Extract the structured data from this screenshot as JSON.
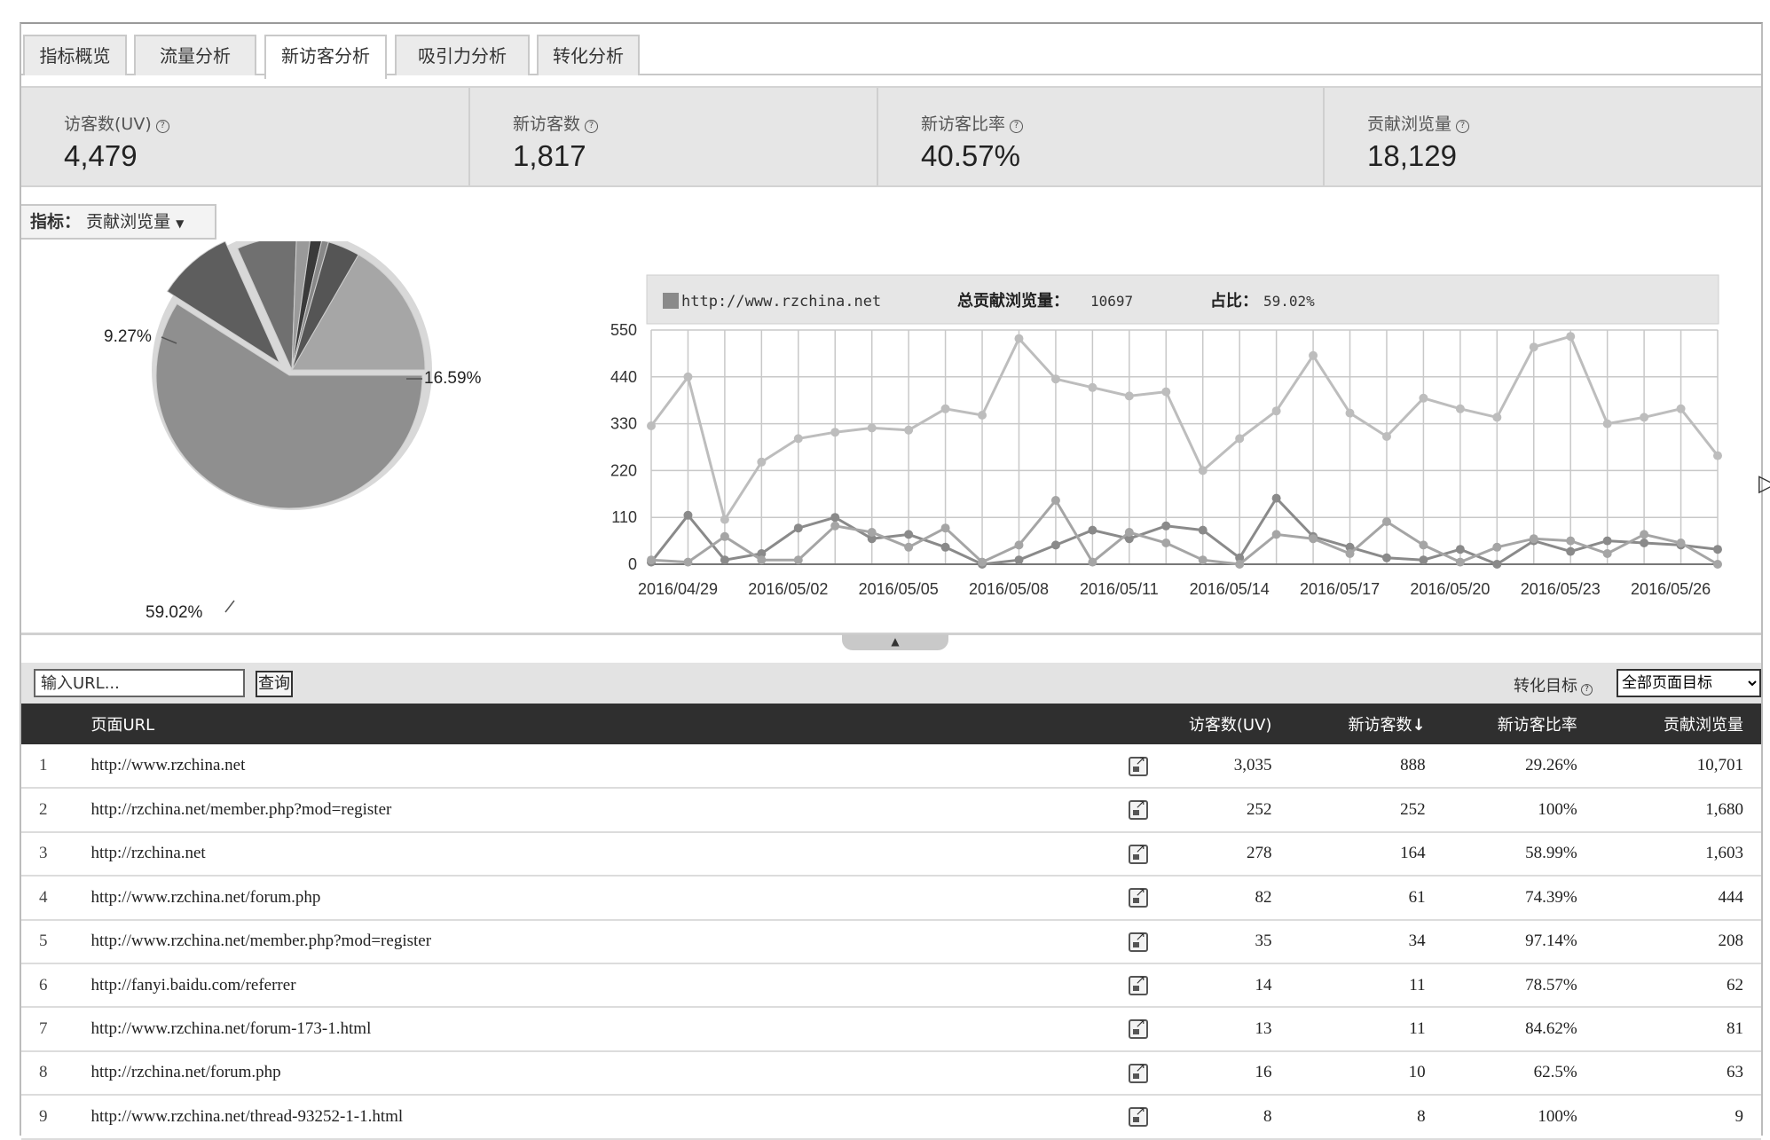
{
  "tabs": [
    {
      "label": "指标概览",
      "active": false
    },
    {
      "label": "流量分析",
      "active": false
    },
    {
      "label": "新访客分析",
      "active": true
    },
    {
      "label": "吸引力分析",
      "active": false
    },
    {
      "label": "转化分析",
      "active": false
    }
  ],
  "metrics": [
    {
      "label": "访客数(UV)",
      "value": "4,479"
    },
    {
      "label": "新访客数",
      "value": "1,817"
    },
    {
      "label": "新访客比率",
      "value": "40.57%"
    },
    {
      "label": "贡献浏览量",
      "value": "18,129"
    }
  ],
  "indicator": {
    "prefix": "指标：",
    "value": "贡献浏览量",
    "arrow": "▼"
  },
  "pie_chart": {
    "labels": [
      "16.59%",
      "9.27%",
      "59.02%"
    ],
    "colors": {
      "main": "#8f8f8f",
      "secondary": "#a6a6a6",
      "third": "#5e5e5e",
      "fourth": "#707070",
      "ring": "#d8d8d8"
    }
  },
  "chart_data": {
    "type": "line",
    "legend": {
      "site": "http://www.rzchina.net",
      "total_label": "总贡献浏览量：",
      "total_value": "10697",
      "share_label": "占比：",
      "share_value": "59.02%"
    },
    "x_tick_labels": [
      "2016/04/29",
      "2016/05/02",
      "2016/05/05",
      "2016/05/08",
      "2016/05/11",
      "2016/05/14",
      "2016/05/17",
      "2016/05/20",
      "2016/05/23",
      "2016/05/26"
    ],
    "y_ticks": [
      "0",
      "110",
      "220",
      "330",
      "440",
      "550"
    ],
    "ylim": [
      0,
      550
    ],
    "x_start": "2016/04/29",
    "x_end": "2016/05/28",
    "series": [
      {
        "color": "#bdbdbd",
        "values": [
          325,
          440,
          105,
          240,
          295,
          310,
          320,
          315,
          365,
          350,
          530,
          435,
          415,
          395,
          405,
          220,
          295,
          360,
          490,
          355,
          300,
          390,
          365,
          345,
          510,
          535,
          330,
          345,
          365,
          255
        ]
      },
      {
        "color": "#8a8a8a",
        "values": [
          5,
          115,
          10,
          25,
          85,
          110,
          60,
          70,
          40,
          0,
          10,
          45,
          80,
          60,
          90,
          80,
          15,
          155,
          65,
          40,
          15,
          10,
          35,
          0,
          55,
          30,
          55,
          50,
          45,
          35
        ]
      },
      {
        "color": "#a5a5a5",
        "values": [
          10,
          5,
          65,
          10,
          10,
          90,
          75,
          40,
          85,
          5,
          45,
          150,
          5,
          75,
          50,
          10,
          0,
          70,
          60,
          25,
          100,
          45,
          5,
          40,
          60,
          55,
          25,
          70,
          50,
          0
        ]
      }
    ]
  },
  "search": {
    "placeholder": "输入URL...",
    "button": "查询",
    "goal_label": "转化目标",
    "goal_option": "全部页面目标"
  },
  "table": {
    "headers": {
      "url": "页面URL",
      "uv": "访客数(UV)",
      "new": "新访客数",
      "sort": "↓",
      "rate": "新访客比率",
      "pv": "贡献浏览量"
    },
    "rows": [
      {
        "idx": "1",
        "url": "http://www.rzchina.net",
        "uv": "3,035",
        "new": "888",
        "rate": "29.26%",
        "pv": "10,701"
      },
      {
        "idx": "2",
        "url": "http://rzchina.net/member.php?mod=register",
        "uv": "252",
        "new": "252",
        "rate": "100%",
        "pv": "1,680"
      },
      {
        "idx": "3",
        "url": "http://rzchina.net",
        "uv": "278",
        "new": "164",
        "rate": "58.99%",
        "pv": "1,603"
      },
      {
        "idx": "4",
        "url": "http://www.rzchina.net/forum.php",
        "uv": "82",
        "new": "61",
        "rate": "74.39%",
        "pv": "444"
      },
      {
        "idx": "5",
        "url": "http://www.rzchina.net/member.php?mod=register",
        "uv": "35",
        "new": "34",
        "rate": "97.14%",
        "pv": "208"
      },
      {
        "idx": "6",
        "url": "http://fanyi.baidu.com/referrer",
        "uv": "14",
        "new": "11",
        "rate": "78.57%",
        "pv": "62"
      },
      {
        "idx": "7",
        "url": "http://www.rzchina.net/forum-173-1.html",
        "uv": "13",
        "new": "11",
        "rate": "84.62%",
        "pv": "81"
      },
      {
        "idx": "8",
        "url": "http://rzchina.net/forum.php",
        "uv": "16",
        "new": "10",
        "rate": "62.5%",
        "pv": "63"
      },
      {
        "idx": "9",
        "url": "http://www.rzchina.net/thread-93252-1-1.html",
        "uv": "8",
        "new": "8",
        "rate": "100%",
        "pv": "9"
      }
    ]
  }
}
